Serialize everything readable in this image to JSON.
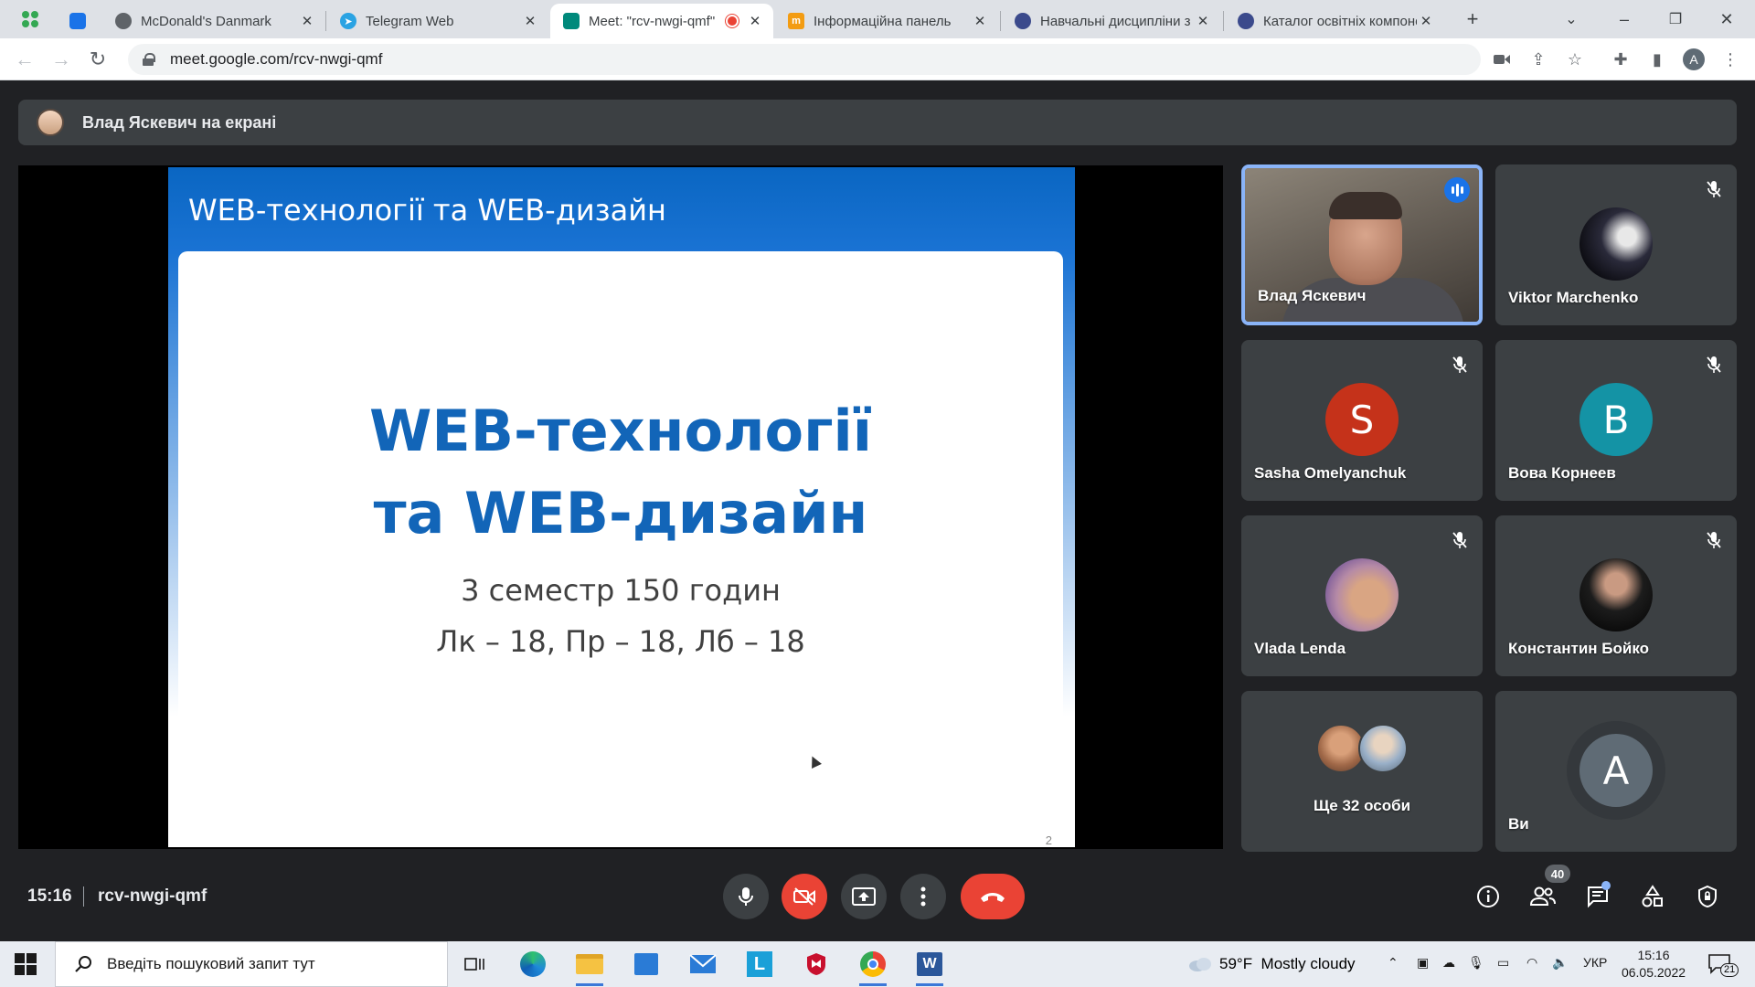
{
  "browser": {
    "tabs": [
      {
        "title": "",
        "active": false
      },
      {
        "title": "McDonald's Danmark",
        "active": false
      },
      {
        "title": "Telegram Web",
        "active": false
      },
      {
        "title": "Meet: \"rcv-nwgi-qmf\"",
        "active": true
      },
      {
        "title": "Інформаційна панель",
        "active": false
      },
      {
        "title": "Навчальні дисципліни з",
        "active": false
      },
      {
        "title": "Каталог освітніх компонентів",
        "active": false
      }
    ],
    "url": "meet.google.com/rcv-nwgi-qmf",
    "profile_initial": "A"
  },
  "meet": {
    "presenter_banner": "Влад Яскевич на екрані",
    "slide": {
      "header": "WEB-технології та WEB-дизайн",
      "title_line1": "WEB-технології",
      "title_line2": "та WEB-дизайн",
      "sub_line1": "3 семестр 150 годин",
      "sub_line2": "Лк – 18, Пр – 18, Лб – 18",
      "page_number": "2"
    },
    "participants": [
      {
        "name": "Влад Яскевич",
        "speaking": true
      },
      {
        "name": "Viktor Marchenko",
        "muted": true
      },
      {
        "name": "Sasha Omelyanchuk",
        "initial": "S",
        "color": "#c5321a",
        "muted": true
      },
      {
        "name": "Вова Корнеев",
        "initial": "В",
        "color": "#1493a5",
        "muted": true
      },
      {
        "name": "Vlada Lenda",
        "muted": true
      },
      {
        "name": "Константин Бойко",
        "muted": true
      },
      {
        "name": "Ще 32 особи"
      },
      {
        "name": "Ви",
        "initial": "A",
        "color": "#5f6b75"
      }
    ],
    "controls": {
      "time": "15:16",
      "meeting_code": "rcv-nwgi-qmf",
      "participant_count": "40"
    },
    "colors": {
      "accent": "#8ab4f8",
      "danger": "#ea4335",
      "panel": "#3c4043",
      "bg": "#202124"
    }
  },
  "taskbar": {
    "search_placeholder": "Введіть пошуковий запит тут",
    "weather": "59°F  Mostly cloudy",
    "language": "УКР",
    "time": "15:16",
    "date": "06.05.2022",
    "notifications": "21"
  }
}
